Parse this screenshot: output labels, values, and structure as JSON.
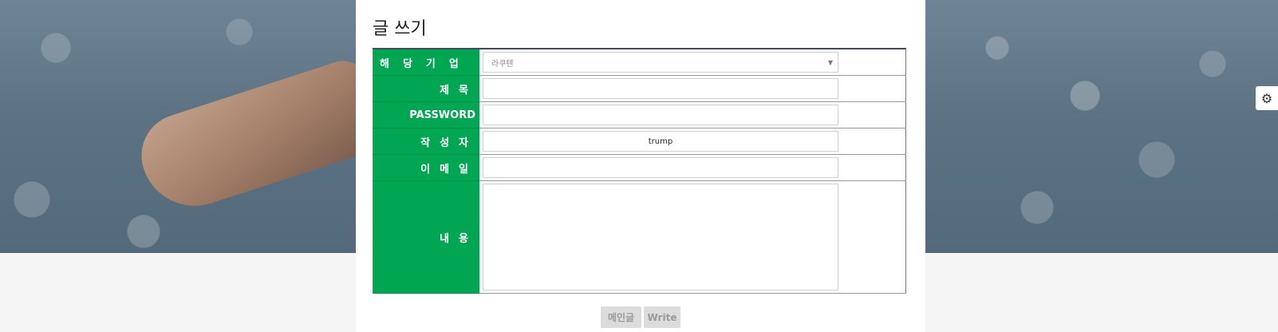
{
  "page": {
    "title": "글 쓰기"
  },
  "form": {
    "rows": [
      {
        "label": "해당기업",
        "value": "라쿠텐",
        "type": "select"
      },
      {
        "label": "제목",
        "value": "",
        "type": "text"
      },
      {
        "label": "PASSWORD",
        "value": "",
        "type": "password"
      },
      {
        "label": "작성자",
        "value": "trump",
        "type": "text"
      },
      {
        "label": "이메일",
        "value": "",
        "type": "text"
      },
      {
        "label": "내용",
        "value": "",
        "type": "textarea"
      }
    ]
  },
  "buttons": {
    "main_label": "메인글",
    "write_label": "Write"
  },
  "icons": {
    "settings": "gear-icon",
    "select_caret": "caret-down-icon"
  },
  "colors": {
    "label_bg": "#00a651",
    "button_bg": "#dcdcdc"
  }
}
